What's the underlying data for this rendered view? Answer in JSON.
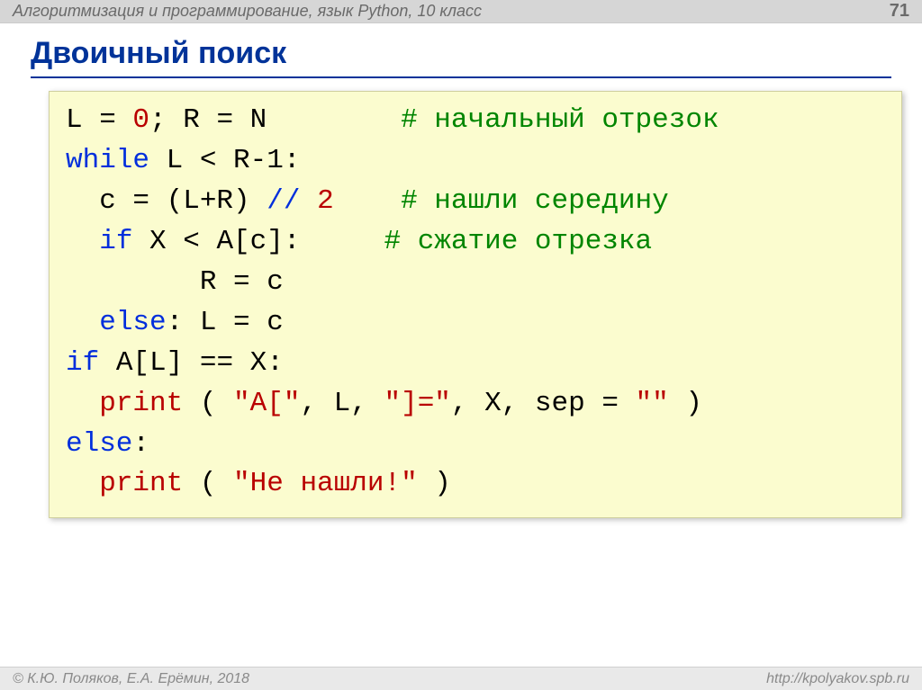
{
  "header": {
    "breadcrumb": "Алгоритмизация и программирование, язык Python, 10 класс",
    "page_number": "71"
  },
  "title": "Двоичный поиск",
  "code": {
    "l1_a": "L",
    "l1_eq": " = ",
    "l1_zero": "0",
    "l1_b": "; R",
    "l1_eq2": " = ",
    "l1_c": "N        ",
    "l1_comment": "# начальный отрезок",
    "l2_kw": "while",
    "l2_rest": " L < R-1:",
    "l3_a": "  c",
    "l3_eq": " = ",
    "l3_b": "(L+R)",
    "l3_op": " // ",
    "l3_two": "2",
    "l3_sp": "    ",
    "l3_comment": "# нашли середину",
    "l4_sp": "  ",
    "l4_kw": "if",
    "l4_a": " X < A[c]:     ",
    "l4_comment": "# сжатие отрезка",
    "l5_a": "        R",
    "l5_eq": " = ",
    "l5_b": "c",
    "l6_sp": "  ",
    "l6_kw": "else",
    "l6_a": ": L",
    "l6_eq": " = ",
    "l6_b": "c",
    "l7_kw": "if",
    "l7_a": " A[L]",
    "l7_eq": " == ",
    "l7_b": "X:",
    "l8_sp": "  ",
    "l8_fn": "print",
    "l8_a": " ( ",
    "l8_s1": "\"A[\"",
    "l8_b": ", L, ",
    "l8_s2": "\"]=\"",
    "l8_c": ", X, sep",
    "l8_eq": " = ",
    "l8_s3": "\"\"",
    "l8_d": " )",
    "l9_kw": "else",
    "l9_a": ":",
    "l10_sp": "  ",
    "l10_fn": "print",
    "l10_a": " ( ",
    "l10_s": "\"Не нашли!\"",
    "l10_b": " )"
  },
  "footer": {
    "left": "© К.Ю. Поляков, Е.А. Ерёмин, 2018",
    "right": "http://kpolyakov.spb.ru"
  }
}
